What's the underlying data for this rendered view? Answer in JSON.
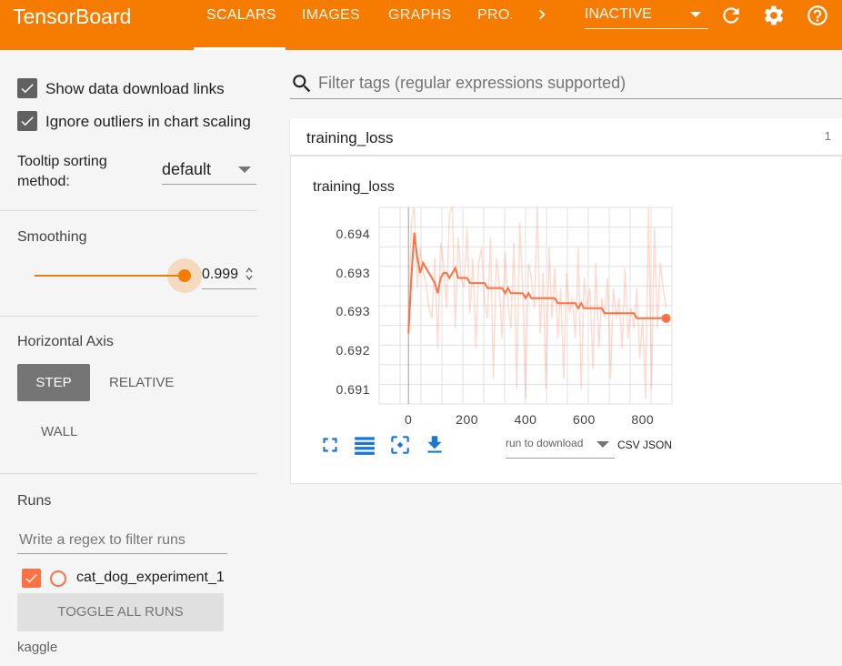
{
  "app": {
    "title": "TensorBoard"
  },
  "tabs": [
    {
      "label": "SCALARS",
      "active": true
    },
    {
      "label": "IMAGES"
    },
    {
      "label": "GRAPHS"
    },
    {
      "label": "PRO..."
    }
  ],
  "top_right": {
    "status_select": "INACTIVE",
    "icons": [
      "refresh-icon",
      "settings-icon",
      "help-icon"
    ]
  },
  "sidebar": {
    "show_download_links": {
      "label": "Show data download links",
      "checked": true
    },
    "ignore_outliers": {
      "label": "Ignore outliers in chart scaling",
      "checked": true
    },
    "tooltip_sorting": {
      "label": "Tooltip sorting method:",
      "value": "default"
    },
    "smoothing": {
      "title": "Smoothing",
      "value": "0.999"
    },
    "horizontal_axis": {
      "title": "Horizontal Axis",
      "options": [
        "STEP",
        "RELATIVE",
        "WALL"
      ],
      "selected": "STEP"
    },
    "runs": {
      "title": "Runs",
      "filter_placeholder": "Write a regex to filter runs",
      "items": [
        {
          "name": "cat_dog_experiment_1",
          "checked": true,
          "color": "#ff7043"
        }
      ],
      "toggle_all_label": "TOGGLE ALL RUNS",
      "footer": "kaggle"
    }
  },
  "main": {
    "filter_placeholder": "Filter tags (regular expressions supported)",
    "tag_group": {
      "name": "training_loss",
      "count": "1"
    },
    "chart_card": {
      "title": "training_loss",
      "run_select": "run to download",
      "csv_label": "CSV",
      "json_label": "JSON",
      "tool_icons": [
        "fullscreen-icon",
        "log-scale-icon",
        "fit-domain-icon",
        "download-icon"
      ]
    }
  },
  "colors": {
    "accent": "#f57c00",
    "series": "#ff7043"
  },
  "chart_data": {
    "type": "line",
    "title": "training_loss",
    "x_ticks": [
      0,
      200,
      400,
      600,
      800
    ],
    "y_ticks": [
      "0.694",
      "0.693",
      "0.693",
      "0.692",
      "0.691"
    ],
    "xlim": [
      -100,
      900
    ],
    "ylim": [
      0.6907,
      0.6946
    ],
    "grid": true,
    "series": [
      {
        "name": "cat_dog_experiment_1",
        "style": "smoothed",
        "x": [
          0,
          10,
          20,
          30,
          40,
          50,
          60,
          70,
          80,
          90,
          100,
          110,
          120,
          130,
          140,
          150,
          160,
          170,
          180,
          190,
          200,
          210,
          220,
          230,
          240,
          250,
          260,
          270,
          280,
          290,
          300,
          310,
          320,
          330,
          340,
          350,
          360,
          370,
          380,
          390,
          400,
          410,
          420,
          430,
          440,
          450,
          460,
          470,
          480,
          490,
          500,
          510,
          520,
          530,
          540,
          550,
          560,
          570,
          580,
          590,
          600,
          610,
          620,
          630,
          640,
          650,
          660,
          670,
          680,
          690,
          700,
          710,
          720,
          730,
          740,
          750,
          760,
          770,
          780,
          790,
          800,
          810,
          820,
          830,
          840,
          850,
          860,
          870,
          880
        ],
        "y": [
          0.6921,
          0.6932,
          0.6941,
          0.6936,
          0.6933,
          0.6935,
          0.6934,
          0.6933,
          0.6932,
          0.6931,
          0.6929,
          0.6932,
          0.6933,
          0.6933,
          0.6932,
          0.6933,
          0.6934,
          0.6932,
          0.6932,
          0.6932,
          0.6932,
          0.6931,
          0.6931,
          0.6931,
          0.6931,
          0.6931,
          0.6931,
          0.693,
          0.693,
          0.693,
          0.693,
          0.693,
          0.693,
          0.6929,
          0.693,
          0.6929,
          0.6929,
          0.6929,
          0.6929,
          0.6929,
          0.6928,
          0.6929,
          0.6928,
          0.6928,
          0.6928,
          0.6928,
          0.6928,
          0.6928,
          0.6928,
          0.6928,
          0.6928,
          0.6927,
          0.6927,
          0.6927,
          0.6927,
          0.6927,
          0.6927,
          0.6927,
          0.6926,
          0.6927,
          0.6926,
          0.6926,
          0.6926,
          0.6926,
          0.6926,
          0.6926,
          0.6926,
          0.6925,
          0.6925,
          0.6925,
          0.6925,
          0.6925,
          0.6925,
          0.6925,
          0.6925,
          0.6925,
          0.6925,
          0.6925,
          0.6924,
          0.6924,
          0.6924,
          0.6924,
          0.6924,
          0.6924,
          0.6924,
          0.6924,
          0.6924,
          0.6924,
          0.6924
        ]
      },
      {
        "name": "cat_dog_experiment_1",
        "style": "raw",
        "x": [
          0,
          10,
          20,
          30,
          40,
          50,
          60,
          70,
          80,
          90,
          100,
          110,
          120,
          130,
          140,
          150,
          160,
          170,
          180,
          190,
          200,
          210,
          220,
          230,
          240,
          250,
          260,
          270,
          280,
          290,
          300,
          310,
          320,
          330,
          340,
          350,
          360,
          370,
          380,
          390,
          400,
          410,
          420,
          430,
          440,
          450,
          460,
          470,
          480,
          490,
          500,
          510,
          520,
          530,
          540,
          550,
          560,
          570,
          580,
          590,
          600,
          610,
          620,
          630,
          640,
          650,
          660,
          670,
          680,
          690,
          700,
          710,
          720,
          730,
          740,
          750,
          760,
          770,
          780,
          790,
          800,
          810,
          820,
          830,
          840,
          850,
          860,
          870,
          880
        ],
        "y": [
          0.6921,
          0.6943,
          0.6946,
          0.693,
          0.6938,
          0.6933,
          0.6931,
          0.6926,
          0.6924,
          0.6936,
          0.6918,
          0.6939,
          0.6935,
          0.6926,
          0.6945,
          0.6946,
          0.6922,
          0.694,
          0.6932,
          0.693,
          0.6942,
          0.6925,
          0.6936,
          0.6918,
          0.6935,
          0.6938,
          0.6927,
          0.6924,
          0.694,
          0.6912,
          0.6936,
          0.6931,
          0.692,
          0.6937,
          0.6927,
          0.6922,
          0.6939,
          0.691,
          0.6943,
          0.693,
          0.6908,
          0.6935,
          0.6932,
          0.6926,
          0.6946,
          0.6921,
          0.6933,
          0.691,
          0.6938,
          0.6924,
          0.6934,
          0.692,
          0.693,
          0.6912,
          0.6933,
          0.6925,
          0.6928,
          0.692,
          0.6938,
          0.691,
          0.6932,
          0.6926,
          0.693,
          0.6914,
          0.6935,
          0.6918,
          0.6928,
          0.6924,
          0.6932,
          0.6912,
          0.693,
          0.6924,
          0.6928,
          0.6918,
          0.6934,
          0.692,
          0.6926,
          0.6922,
          0.693,
          0.6916,
          0.6924,
          0.6908,
          0.6946,
          0.691,
          0.6942,
          0.6922,
          0.6935,
          0.693,
          0.6926
        ]
      }
    ]
  }
}
